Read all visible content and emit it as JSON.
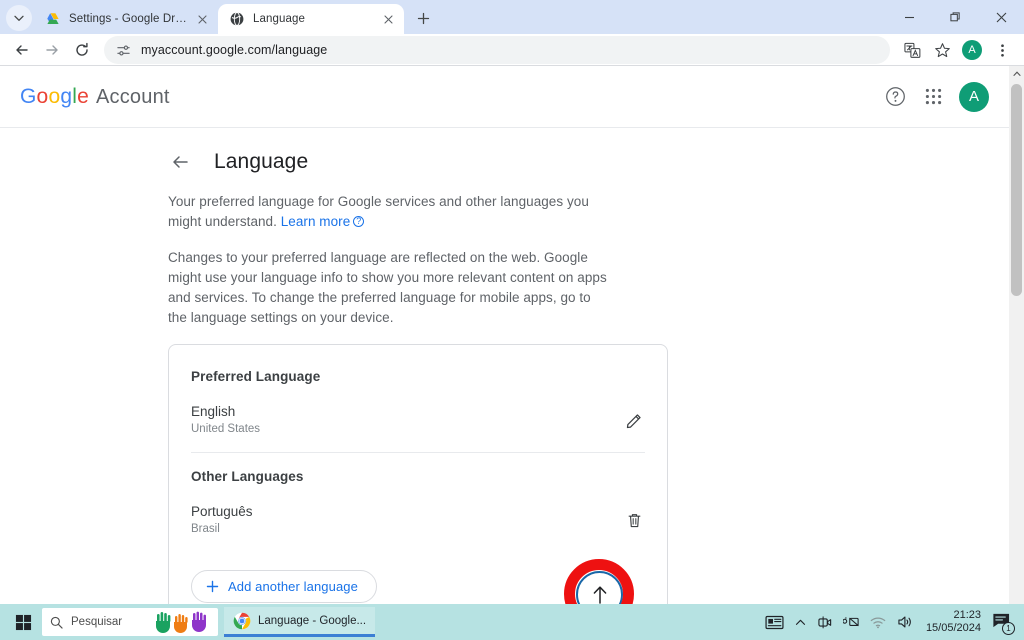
{
  "browser": {
    "tabs": [
      {
        "title": "Settings - Google Drive",
        "favicon": "google-drive-icon",
        "active": false
      },
      {
        "title": "Language",
        "favicon": "globe-icon",
        "active": true
      }
    ],
    "new_tab_label": "+",
    "tab_list_icon": "chevron-down-icon",
    "nav": {
      "back_icon": "back-arrow-icon",
      "forward_icon": "forward-arrow-icon",
      "reload_icon": "reload-icon"
    },
    "omnibox": {
      "url": "myaccount.google.com/language",
      "site_icon": "tune-sliders-icon"
    },
    "toolbar_right": {
      "translate_icon": "translate-icon",
      "bookmark_icon": "star-icon",
      "profile_initial": "A",
      "menu_icon": "three-dots-icon"
    },
    "window_controls": {
      "minimize": "minimize-icon",
      "maximize": "restore-icon",
      "close": "close-icon"
    }
  },
  "page": {
    "brand": {
      "google_letters": [
        "G",
        "o",
        "o",
        "g",
        "l",
        "e"
      ],
      "account_word": "Account"
    },
    "header_icons": {
      "help": "help-circle-icon",
      "apps": "apps-grid-icon",
      "avatar_initial": "A"
    },
    "title": "Language",
    "back_icon": "back-arrow-icon",
    "descriptions": {
      "para1_before_link": "Your preferred language for Google services and other languages you might understand. ",
      "para1_link": "Learn more",
      "para2": "Changes to your preferred language are reflected on the web. Google might use your language info to show you more relevant content on apps and services. To change the preferred language for mobile apps, go to the language settings on your device."
    },
    "card": {
      "preferred_section_title": "Preferred Language",
      "preferred_language": {
        "name": "English",
        "region": "United States",
        "edit_icon": "pencil-edit-icon"
      },
      "other_section_title": "Other Languages",
      "other_languages": [
        {
          "name": "Português",
          "region": "Brasil",
          "move_up_icon": "arrow-up-icon",
          "delete_icon": "trash-icon"
        }
      ],
      "add_button": {
        "label": "Add another language",
        "icon": "plus-icon"
      }
    },
    "annotation": {
      "shape": "red-circle-highlight",
      "target": "move-up-button",
      "color": "#ee1111"
    }
  },
  "taskbar": {
    "start_icon": "windows-start-icon",
    "search": {
      "placeholder": "Pesquisar",
      "icon": "search-icon",
      "decoration_icon": "colored-hands-icon"
    },
    "apps": [
      {
        "label": "Language - Google...",
        "icon": "chrome-icon",
        "active": true
      }
    ],
    "tray": {
      "widgets_icon": "widgets-news-icon",
      "overflow_icon": "chevron-up-icon",
      "meet_icon": "camera-icon",
      "keyboard_icon": "keyboard-off-icon",
      "wifi_icon": "wifi-icon",
      "volume_icon": "volume-icon",
      "time": "21:23",
      "date": "15/05/2024",
      "notification_icon": "notification-icon",
      "notification_count": "1"
    }
  }
}
